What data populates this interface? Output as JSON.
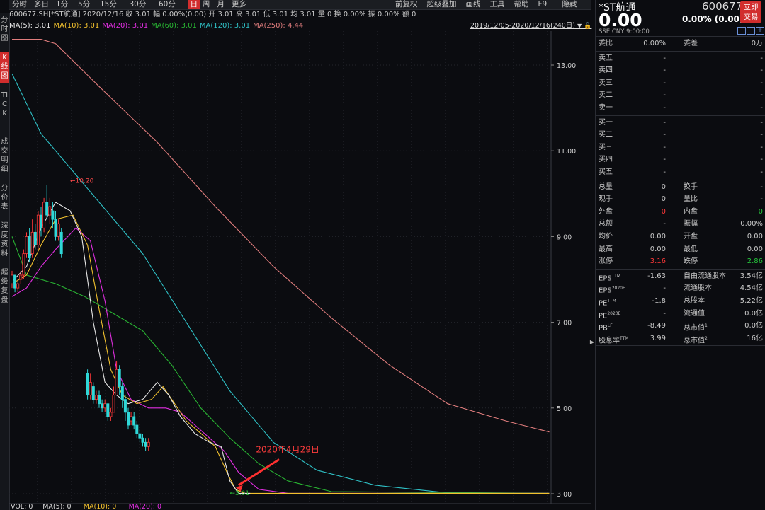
{
  "toolbar": {
    "left": [
      "分时",
      "多日",
      "1分",
      "5分",
      "15分",
      "30分",
      "60分",
      "日",
      "周",
      "月",
      "更多"
    ],
    "active": "日",
    "right": [
      "前复权",
      "超级叠加",
      "画线",
      "工具",
      "帮助",
      "F9",
      "隐藏"
    ]
  },
  "sidebar": [
    {
      "label": "分时图",
      "active": false
    },
    {
      "label": "K线图",
      "active": true
    },
    {
      "label": "TICK",
      "active": false
    },
    {
      "label": "成交明细",
      "active": false
    },
    {
      "label": "分价表",
      "active": false
    },
    {
      "label": "深度资料",
      "active": false
    },
    {
      "label": "超级复盘",
      "active": false
    }
  ],
  "info": {
    "code": "600677.SH[*ST航通]",
    "date": "2020/12/16",
    "items": [
      "收 3.01",
      "幅 0.00%(0.00)",
      "开 3.01",
      "高 3.01",
      "低 3.01",
      "均 3.01",
      "量 0",
      "换 0.00%",
      "振 0.00%",
      "额 0"
    ]
  },
  "ma_legend": [
    {
      "label": "MA(5): 3.01",
      "color": "#e8e8e8"
    },
    {
      "label": "MA(10): 3.01",
      "color": "#f2c12e"
    },
    {
      "label": "MA(20): 3.01",
      "color": "#e02ee0"
    },
    {
      "label": "MA(60): 3.01",
      "color": "#29b533"
    },
    {
      "label": "MA(120): 3.01",
      "color": "#2fc1c6"
    },
    {
      "label": "MA(250): 4.44",
      "color": "#e07d7d"
    }
  ],
  "range_label": "2019/12/05-2020/12/16(240日)",
  "volume_legend": [
    {
      "label": "VOL: 0",
      "color": "#dddddd"
    },
    {
      "label": "MA(5): 0",
      "color": "#dddddd"
    },
    {
      "label": "MA(10): 0",
      "color": "#f2c12e"
    },
    {
      "label": "MA(20): 0",
      "color": "#e02ee0"
    }
  ],
  "chart_data": {
    "type": "line",
    "y_ticks": [
      "13.00",
      "11.00",
      "9.00",
      "7.00",
      "5.00",
      "3.00"
    ],
    "ylim": [
      3.0,
      13.0
    ],
    "annotations": {
      "max_label": "10.20",
      "min_label": "3.01",
      "arrow_text": "2020年4月29日"
    },
    "series": [
      {
        "name": "MA(250)",
        "color": "#e07d7d",
        "points": [
          [
            0,
            13.6
          ],
          [
            10,
            13.6
          ],
          [
            15,
            13.5
          ],
          [
            30,
            12.5
          ],
          [
            50,
            11.2
          ],
          [
            70,
            9.7
          ],
          [
            90,
            8.3
          ],
          [
            110,
            7.1
          ],
          [
            130,
            6.0
          ],
          [
            150,
            5.1
          ],
          [
            170,
            4.7
          ],
          [
            185,
            4.44
          ]
        ]
      },
      {
        "name": "MA(120)",
        "color": "#2fc1c6",
        "points": [
          [
            0,
            12.8
          ],
          [
            10,
            11.4
          ],
          [
            20,
            10.6
          ],
          [
            30,
            9.8
          ],
          [
            45,
            8.6
          ],
          [
            60,
            7.0
          ],
          [
            75,
            5.4
          ],
          [
            90,
            4.2
          ],
          [
            105,
            3.55
          ],
          [
            125,
            3.2
          ],
          [
            150,
            3.02
          ],
          [
            185,
            3.01
          ]
        ]
      },
      {
        "name": "MA(60)",
        "color": "#29b533",
        "points": [
          [
            0,
            9.0
          ],
          [
            5,
            8.1
          ],
          [
            15,
            7.9
          ],
          [
            25,
            7.6
          ],
          [
            35,
            7.2
          ],
          [
            45,
            6.8
          ],
          [
            55,
            6.0
          ],
          [
            65,
            5.0
          ],
          [
            75,
            4.3
          ],
          [
            85,
            3.7
          ],
          [
            95,
            3.3
          ],
          [
            110,
            3.05
          ],
          [
            185,
            3.01
          ]
        ]
      },
      {
        "name": "MA(20)",
        "color": "#e02ee0",
        "points": [
          [
            0,
            7.6
          ],
          [
            5,
            7.8
          ],
          [
            10,
            8.3
          ],
          [
            15,
            8.7
          ],
          [
            22,
            9.2
          ],
          [
            27,
            8.9
          ],
          [
            32,
            7.5
          ],
          [
            36,
            5.9
          ],
          [
            41,
            5.2
          ],
          [
            47,
            5.0
          ],
          [
            53,
            5.0
          ],
          [
            58,
            4.9
          ],
          [
            63,
            4.6
          ],
          [
            68,
            4.3
          ],
          [
            73,
            4.0
          ],
          [
            78,
            3.5
          ],
          [
            85,
            3.1
          ],
          [
            95,
            3.01
          ],
          [
            185,
            3.01
          ]
        ]
      },
      {
        "name": "MA(10)",
        "color": "#f2c12e",
        "points": [
          [
            0,
            7.9
          ],
          [
            5,
            8.1
          ],
          [
            10,
            8.8
          ],
          [
            15,
            9.4
          ],
          [
            21,
            9.5
          ],
          [
            26,
            8.8
          ],
          [
            30,
            7.3
          ],
          [
            34,
            5.9
          ],
          [
            38,
            5.3
          ],
          [
            43,
            5.1
          ],
          [
            48,
            5.2
          ],
          [
            52,
            5.5
          ],
          [
            56,
            5.1
          ],
          [
            60,
            4.7
          ],
          [
            66,
            4.35
          ],
          [
            70,
            4.1
          ],
          [
            74,
            3.5
          ],
          [
            77,
            3.1
          ],
          [
            80,
            3.01
          ],
          [
            185,
            3.01
          ]
        ]
      },
      {
        "name": "MA(5)",
        "color": "#e8e8e8",
        "points": [
          [
            0,
            7.95
          ],
          [
            5,
            8.3
          ],
          [
            10,
            9.2
          ],
          [
            15,
            9.8
          ],
          [
            20,
            9.6
          ],
          [
            24,
            9.0
          ],
          [
            28,
            7.0
          ],
          [
            32,
            5.6
          ],
          [
            36,
            5.3
          ],
          [
            40,
            5.1
          ],
          [
            45,
            5.2
          ],
          [
            50,
            5.6
          ],
          [
            54,
            5.3
          ],
          [
            58,
            4.8
          ],
          [
            63,
            4.4
          ],
          [
            68,
            4.2
          ],
          [
            72,
            4.1
          ],
          [
            75,
            3.3
          ],
          [
            78,
            3.01
          ],
          [
            82,
            3.01
          ]
        ]
      }
    ],
    "candles": [
      [
        0,
        7.9,
        8.1,
        8.2,
        7.8
      ],
      [
        1,
        8.1,
        7.8,
        8.1,
        7.7
      ],
      [
        2,
        7.8,
        7.9,
        8.0,
        7.7
      ],
      [
        3,
        8.0,
        8.1,
        8.2,
        7.9
      ],
      [
        4,
        8.1,
        8.6,
        8.7,
        8.0
      ],
      [
        5,
        8.6,
        9.0,
        9.1,
        8.5
      ],
      [
        6,
        9.0,
        8.5,
        9.2,
        8.4
      ],
      [
        7,
        8.6,
        9.1,
        9.4,
        8.5
      ],
      [
        8,
        9.1,
        8.8,
        9.3,
        8.7
      ],
      [
        9,
        8.8,
        9.5,
        9.6,
        8.7
      ],
      [
        10,
        9.5,
        9.2,
        9.7,
        9.0
      ],
      [
        11,
        9.2,
        9.8,
        9.9,
        9.1
      ],
      [
        12,
        9.8,
        9.5,
        10.2,
        9.4
      ],
      [
        13,
        9.5,
        9.7,
        9.9,
        9.3
      ],
      [
        14,
        9.6,
        9.4,
        9.8,
        9.2
      ],
      [
        15,
        9.4,
        9.0,
        9.6,
        8.9
      ],
      [
        16,
        9.0,
        9.3,
        9.4,
        8.9
      ],
      [
        17,
        9.1,
        8.6,
        9.2,
        8.5
      ],
      [
        26,
        5.8,
        5.3,
        5.9,
        5.2
      ],
      [
        27,
        5.3,
        5.6,
        5.8,
        5.2
      ],
      [
        28,
        5.5,
        5.2,
        5.6,
        5.1
      ],
      [
        29,
        5.2,
        5.3,
        5.4,
        5.1
      ],
      [
        30,
        5.3,
        5.1,
        5.4,
        5.0
      ],
      [
        31,
        5.1,
        5.0,
        5.2,
        4.9
      ],
      [
        32,
        5.0,
        5.1,
        5.2,
        4.9
      ],
      [
        33,
        5.1,
        4.8,
        5.1,
        4.7
      ],
      [
        34,
        4.8,
        4.9,
        5.0,
        4.7
      ],
      [
        35,
        4.9,
        5.3,
        5.5,
        4.9
      ],
      [
        36,
        5.3,
        5.9,
        6.1,
        5.3
      ],
      [
        37,
        5.9,
        5.5,
        6.0,
        5.3
      ],
      [
        38,
        5.5,
        5.2,
        5.6,
        5.0
      ],
      [
        39,
        5.2,
        4.9,
        5.3,
        4.7
      ],
      [
        40,
        4.9,
        4.6,
        5.0,
        4.5
      ],
      [
        41,
        4.7,
        4.8,
        4.9,
        4.6
      ],
      [
        42,
        4.8,
        4.6,
        4.9,
        4.5
      ],
      [
        43,
        4.6,
        4.4,
        4.7,
        4.3
      ],
      [
        44,
        4.4,
        4.3,
        4.5,
        4.2
      ],
      [
        45,
        4.3,
        4.2,
        4.4,
        4.1
      ],
      [
        46,
        4.2,
        4.1,
        4.3,
        4.0
      ],
      [
        47,
        4.1,
        4.2,
        4.3,
        4.0
      ]
    ]
  },
  "quote": {
    "name": "*ST航通",
    "code": "600677",
    "price": "0.00",
    "change": "0.00% (0.00)",
    "market": "SSE  CNY  9:00:00",
    "trade_button": "立即交易",
    "weibi": {
      "l": "委比",
      "v1": "0.00%",
      "l2": "委差",
      "v2": "0万"
    },
    "asks": [
      {
        "l": "卖五",
        "v": "-",
        "v2": "-"
      },
      {
        "l": "卖四",
        "v": "-",
        "v2": "-"
      },
      {
        "l": "卖三",
        "v": "-",
        "v2": "-"
      },
      {
        "l": "卖二",
        "v": "-",
        "v2": "-"
      },
      {
        "l": "卖一",
        "v": "-",
        "v2": "-"
      }
    ],
    "bids": [
      {
        "l": "买一",
        "v": "-",
        "v2": "-"
      },
      {
        "l": "买二",
        "v": "-",
        "v2": "-"
      },
      {
        "l": "买三",
        "v": "-",
        "v2": "-"
      },
      {
        "l": "买四",
        "v": "-",
        "v2": "-"
      },
      {
        "l": "买五",
        "v": "-",
        "v2": "-"
      }
    ],
    "stats": [
      {
        "l": "总量",
        "v1": "0",
        "l2": "换手",
        "v2": "-"
      },
      {
        "l": "现手",
        "v1": "0",
        "l2": "量比",
        "v2": "-"
      },
      {
        "l": "外盘",
        "v1": "0",
        "l2": "内盘",
        "v2": "0",
        "c1": "red",
        "c2": "green"
      },
      {
        "l": "总额",
        "v1": "-",
        "l2": "振幅",
        "v2": "0.00%"
      },
      {
        "l": "均价",
        "v1": "0.00",
        "l2": "开盘",
        "v2": "0.00"
      },
      {
        "l": "最高",
        "v1": "0.00",
        "l2": "最低",
        "v2": "0.00"
      },
      {
        "l": "涨停",
        "v1": "3.16",
        "l2": "跌停",
        "v2": "2.86",
        "c1": "red",
        "c2": "green"
      }
    ],
    "finance": [
      {
        "l": "EPS",
        "sup": "TTM",
        "v1": "-1.63",
        "l2": "自由流通股本",
        "sup2": "",
        "v2": "3.54亿"
      },
      {
        "l": "EPS",
        "sup": "2020E",
        "v1": "-",
        "l2": "流通股本",
        "sup2": "",
        "v2": "4.54亿"
      },
      {
        "l": "PE",
        "sup": "TTM",
        "v1": "-1.8",
        "l2": "总股本",
        "sup2": "",
        "v2": "5.22亿"
      },
      {
        "l": "PE",
        "sup": "2020E",
        "v1": "-",
        "l2": "流通值",
        "sup2": "",
        "v2": "0.0亿"
      },
      {
        "l": "PB",
        "sup": "LF",
        "v1": "-8.49",
        "l2": "总市值",
        "sup2": "1",
        "v2": "0.0亿"
      },
      {
        "l": "股息率",
        "sup": "TTM",
        "v1": "3.99",
        "l2": "总市值",
        "sup2": "2",
        "v2": "16亿"
      }
    ]
  }
}
